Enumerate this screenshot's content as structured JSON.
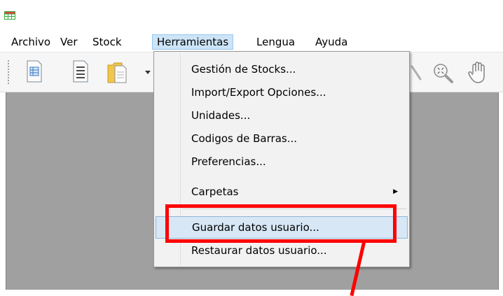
{
  "menubar": {
    "items": [
      "Archivo",
      "Ver",
      "Stock",
      "Herramientas",
      "Lengua",
      "Ayuda"
    ]
  },
  "dropdown": {
    "items": [
      {
        "label": "Gestión de Stocks..."
      },
      {
        "label": "Import/Export Opciones..."
      },
      {
        "label": "Unidades..."
      },
      {
        "label": "Codigos de Barras..."
      },
      {
        "label": "Preferencias..."
      },
      {
        "label": "Carpetas",
        "submenu_arrow": "▶"
      },
      {
        "label": "Guardar datos usuario...",
        "highlighted": true
      },
      {
        "label": "Restaurar datos usuario..."
      }
    ]
  },
  "icons": {
    "toolbar": [
      "grid-document-icon",
      "list-document-icon",
      "folder-document-icon",
      "zoom-icon",
      "zoom-fit-icon",
      "hand-pan-icon"
    ]
  },
  "colors": {
    "menu_highlight": "#cce4f7",
    "item_highlight": "#d7e7f5",
    "annotation": "#ff0000",
    "workspace": "#a0a0a0"
  }
}
